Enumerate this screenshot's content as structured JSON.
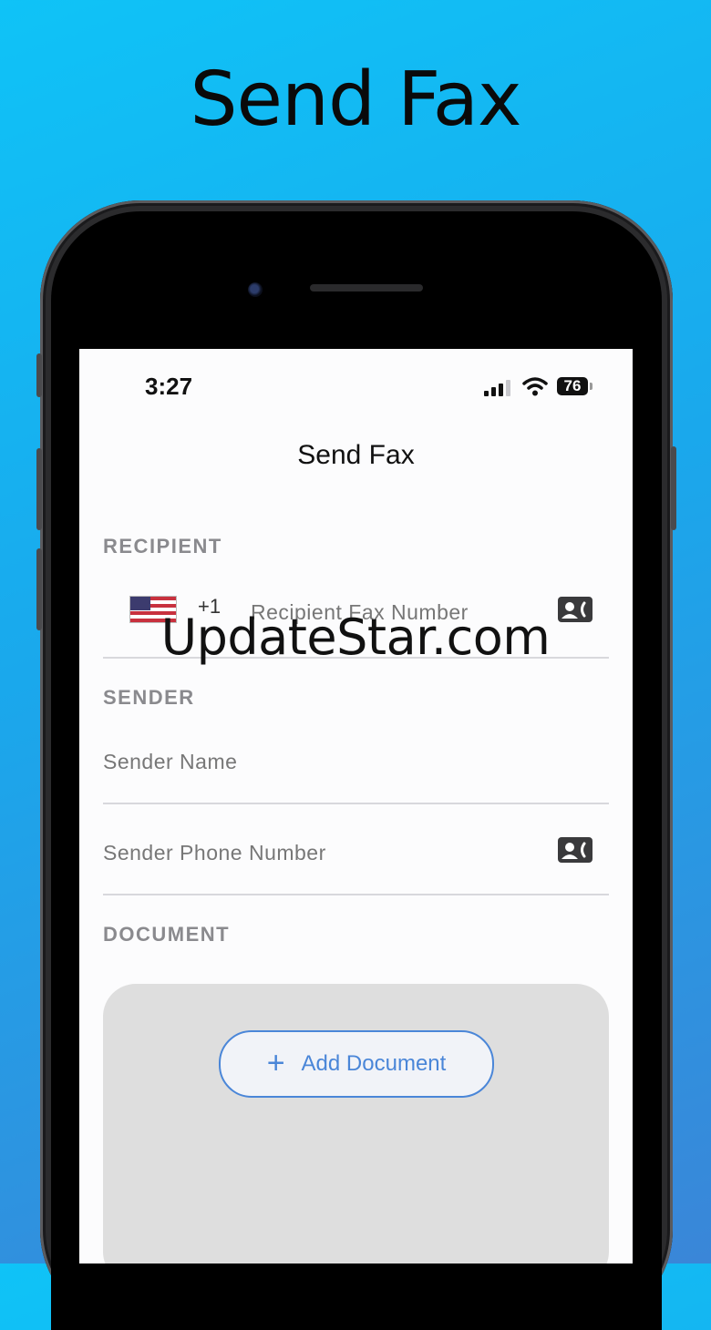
{
  "headline": "Send Fax",
  "watermark": "UpdateStar.com",
  "status_bar": {
    "time": "3:27",
    "battery": "76"
  },
  "nav": {
    "title": "Send Fax"
  },
  "recipient": {
    "section_label": "RECIPIENT",
    "country_code": "+1",
    "fax_placeholder": "Recipient Fax Number"
  },
  "sender": {
    "section_label": "SENDER",
    "name_placeholder": "Sender Name",
    "phone_placeholder": "Sender Phone Number"
  },
  "document": {
    "section_label": "DOCUMENT",
    "add_label": "Add Document"
  },
  "colors": {
    "accent": "#4a86d8",
    "background_top": "#0fc3f7",
    "background_bottom": "#3a86d8"
  }
}
